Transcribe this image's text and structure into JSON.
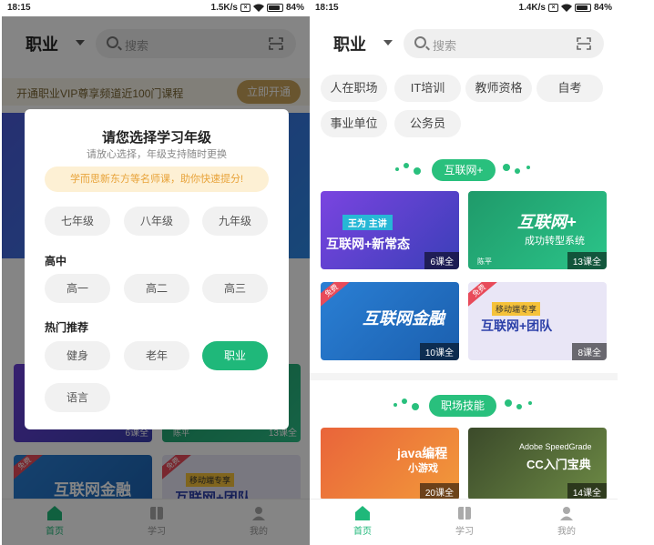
{
  "left": {
    "status": {
      "time": "18:15",
      "speed": "1.5K/s",
      "battery": "84%"
    },
    "header": {
      "title": "职业",
      "search_placeholder": "搜索"
    },
    "vip": {
      "text": "开通职业VIP尊享频道近100门课程",
      "button": "立即开通"
    },
    "underlay_cards": [
      {
        "count": "6课全"
      },
      {
        "count": "13课全",
        "author": "陈平"
      },
      {
        "title": "互联网金融",
        "badge": "免费"
      },
      {
        "title": "互联网+团队",
        "badge": "免费",
        "tag": "移动端专享"
      }
    ],
    "modal": {
      "title": "请您选择学习年级",
      "subtitle": "请放心选择，年级支持随时更换",
      "promo": "学而思新东方等名师课，助你快速提分!",
      "row1": [
        "七年级",
        "八年级",
        "九年级"
      ],
      "section_high": "高中",
      "row2": [
        "高一",
        "高二",
        "高三"
      ],
      "section_hot": "热门推荐",
      "row3": [
        "健身",
        "老年",
        "职业"
      ],
      "row4": [
        "语言"
      ],
      "selected": "职业"
    },
    "tabbar": [
      "首页",
      "学习",
      "我的"
    ]
  },
  "right": {
    "status": {
      "time": "18:15",
      "speed": "1.4K/s",
      "battery": "84%"
    },
    "header": {
      "title": "职业",
      "search_placeholder": "搜索"
    },
    "categories": [
      "人在职场",
      "IT培训",
      "教师资格",
      "自考",
      "事业单位",
      "公务员"
    ],
    "section1": "互联网+",
    "courses1": [
      {
        "line1": "王为 主讲",
        "line2": "互联网+新常态",
        "count": "6课全",
        "color": "#6a3fd6"
      },
      {
        "line1": "互联网+",
        "line2": "成功转型系统",
        "author": "陈平",
        "count": "13课全",
        "color": "#1f9a6a"
      },
      {
        "line1": "互联网金融",
        "line2": "",
        "badge": "免费",
        "count": "10课全",
        "color": "#2a7fd4"
      },
      {
        "line1": "移动端专享",
        "line2": "互联网+团队",
        "badge": "免费",
        "count": "8课全",
        "color": "#e9e6f6"
      }
    ],
    "section2": "职场技能",
    "courses2": [
      {
        "line1": "java编程",
        "line2": "小游戏",
        "count": "20课全",
        "color": "#e6643a"
      },
      {
        "line1": "Adobe SpeedGrade",
        "line2": "CC入门宝典",
        "count": "14课全",
        "color": "#5d7a3a"
      }
    ],
    "tabbar": [
      "首页",
      "学习",
      "我的"
    ]
  },
  "colors": {
    "accent": "#1fb87a",
    "gold": "#c9a35a"
  }
}
